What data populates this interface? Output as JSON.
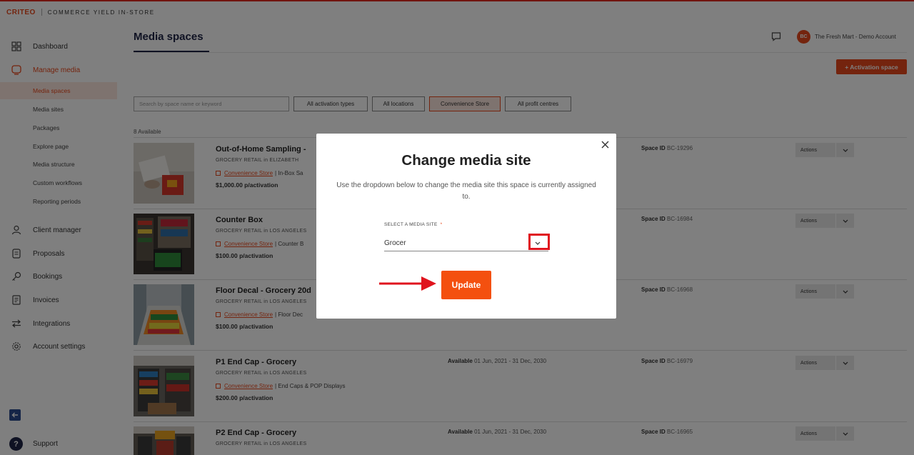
{
  "brand": {
    "logo": "CRITEO",
    "product": "COMMERCE YIELD IN-STORE",
    "accent": "#e8491d"
  },
  "sidebar": {
    "items": [
      {
        "label": "Dashboard",
        "icon": "grid-icon"
      },
      {
        "label": "Manage media",
        "icon": "monitor-icon"
      },
      {
        "label": "Client manager",
        "icon": "user-icon"
      },
      {
        "label": "Proposals",
        "icon": "document-icon"
      },
      {
        "label": "Bookings",
        "icon": "key-icon"
      },
      {
        "label": "Invoices",
        "icon": "invoice-icon"
      },
      {
        "label": "Integrations",
        "icon": "arrows-icon"
      },
      {
        "label": "Account settings",
        "icon": "gear-icon"
      }
    ],
    "subitems": [
      "Media spaces",
      "Media sites",
      "Packages",
      "Explore page",
      "Media structure",
      "Custom workflows",
      "Reporting periods"
    ],
    "support": "Support"
  },
  "header": {
    "title": "Media spaces",
    "avatar": "BC",
    "account": "The Fresh Mart - Demo Account",
    "activation_button": "+ Activation space"
  },
  "filters": {
    "search_placeholder": "Search by space name or keyword",
    "buttons": [
      "All activation types",
      "All locations",
      "Convenience Store",
      "All profit centres"
    ]
  },
  "count": "8 Available",
  "cards": [
    {
      "title": "Out-of-Home Sampling -",
      "sub": "GROCERY RETAIL in ELIZABETH",
      "link": "Convenience Store",
      "after": "| In-Box Sa",
      "price": "$1,000.00 p/activation",
      "avail_label": "",
      "avail": "",
      "space_label": "Space ID",
      "space_id": "BC-19296",
      "actions": "Actions"
    },
    {
      "title": "Counter Box",
      "sub": "GROCERY RETAIL in LOS ANGELES",
      "link": "Convenience Store",
      "after": "| Counter B",
      "price": "$100.00 p/activation",
      "avail_label": "",
      "avail": "",
      "space_label": "Space ID",
      "space_id": "BC-16984",
      "actions": "Actions"
    },
    {
      "title": "Floor Decal - Grocery 20d",
      "sub": "GROCERY RETAIL in LOS ANGELES",
      "link": "Convenience Store",
      "after": "| Floor Dec",
      "price": "$100.00 p/activation",
      "avail_label": "",
      "avail": "",
      "space_label": "Space ID",
      "space_id": "BC-16968",
      "actions": "Actions"
    },
    {
      "title": "P1 End Cap - Grocery",
      "sub": "GROCERY RETAIL in LOS ANGELES",
      "link": "Convenience Store",
      "after": "| End Caps & POP Displays",
      "price": "$200.00 p/activation",
      "avail_label": "Available",
      "avail": "01 Jun, 2021 - 31 Dec, 2030",
      "space_label": "Space ID",
      "space_id": "BC-16979",
      "actions": "Actions"
    },
    {
      "title": "P2 End Cap - Grocery",
      "sub": "GROCERY RETAIL in LOS ANGELES",
      "link": "",
      "after": "",
      "price": "",
      "avail_label": "Available",
      "avail": "01 Jun, 2021 - 31 Dec, 2030",
      "space_label": "Space ID",
      "space_id": "BC-16965",
      "actions": "Actions"
    }
  ],
  "modal": {
    "title": "Change media site",
    "description": "Use the dropdown below to change the media site this space is currently assigned to.",
    "label": "SELECT A MEDIA SITE",
    "required": "*",
    "selected": "Grocer",
    "update": "Update"
  }
}
